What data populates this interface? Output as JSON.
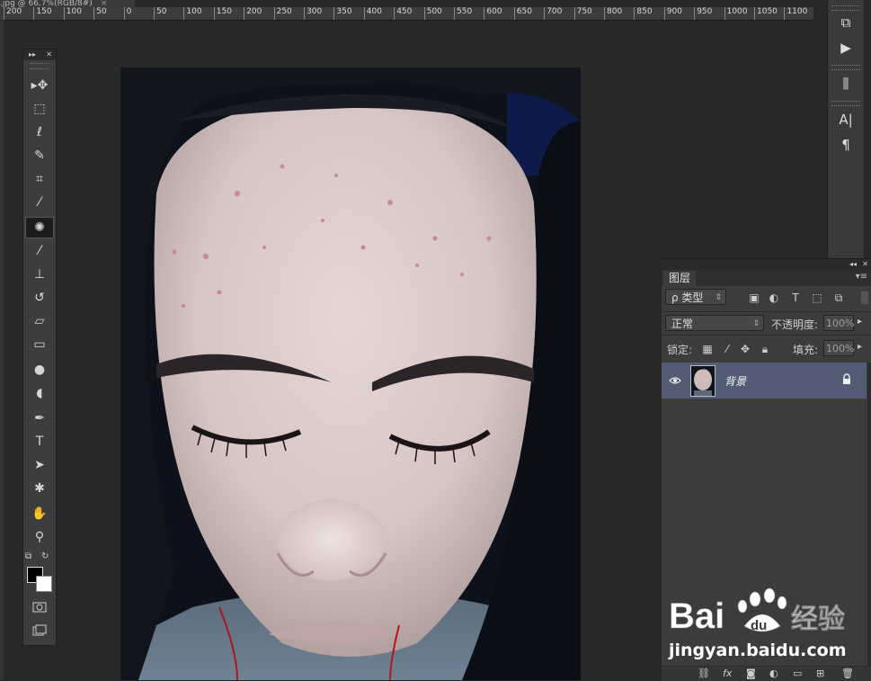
{
  "document_tab": {
    "title": ".jpg @ 66.7%(RGB/8#)",
    "close": "×"
  },
  "ruler": {
    "ticks": [
      "200",
      "150",
      "100",
      "50",
      "0",
      "50",
      "100",
      "150",
      "200",
      "250",
      "300",
      "350",
      "400",
      "450",
      "500",
      "550",
      "600",
      "650",
      "700",
      "750",
      "800",
      "850",
      "900",
      "950",
      "1000",
      "1050",
      "1100"
    ]
  },
  "toolbar": {
    "collapse": "▸▸",
    "close": "✕",
    "tools": [
      {
        "name": "move-tool",
        "glyph": "▸✥"
      },
      {
        "name": "marquee-tool",
        "glyph": "⬚"
      },
      {
        "name": "lasso-tool",
        "glyph": "ℓ"
      },
      {
        "name": "quick-select-tool",
        "glyph": "✎"
      },
      {
        "name": "crop-tool",
        "glyph": "⌗"
      },
      {
        "name": "eyedropper-tool",
        "glyph": "⁄"
      },
      {
        "name": "spot-healing-tool",
        "glyph": "✺"
      },
      {
        "name": "brush-tool",
        "glyph": "⁄"
      },
      {
        "name": "clone-stamp-tool",
        "glyph": "⊥"
      },
      {
        "name": "history-brush-tool",
        "glyph": "↺"
      },
      {
        "name": "eraser-tool",
        "glyph": "▱"
      },
      {
        "name": "gradient-tool",
        "glyph": "▭"
      },
      {
        "name": "blur-tool",
        "glyph": "●"
      },
      {
        "name": "dodge-tool",
        "glyph": "◖"
      },
      {
        "name": "pen-tool",
        "glyph": "✒"
      },
      {
        "name": "type-tool",
        "glyph": "T"
      },
      {
        "name": "path-select-tool",
        "glyph": "➤"
      },
      {
        "name": "shape-tool",
        "glyph": "✱"
      },
      {
        "name": "hand-tool",
        "glyph": "✋"
      },
      {
        "name": "zoom-tool",
        "glyph": "⚲"
      }
    ]
  },
  "dock": {
    "buttons": [
      "⧉",
      "▶",
      "⫼",
      "A|",
      "¶"
    ]
  },
  "layers_panel": {
    "tab_label": "图层",
    "filter_type": "ρ 类型",
    "blend_mode": "正常",
    "opacity_label": "不透明度:",
    "opacity_value": "100%",
    "lock_label": "锁定:",
    "fill_label": "填充:",
    "fill_value": "100%",
    "layers": [
      {
        "name": "背景",
        "visible": true,
        "locked": true
      }
    ],
    "bottom_icons": [
      "⛓",
      "fx",
      "◙",
      "◐",
      "▭",
      "⊞",
      "🗑"
    ]
  },
  "watermark": {
    "logo_text": "Bai",
    "logo_du": "du",
    "cn_text": "经验",
    "url": "jingyan.baidu.com"
  },
  "colors": {
    "fg_swatch": "#000000",
    "bg_swatch": "#ffffff",
    "selected_layer_bg": "#525c74"
  }
}
